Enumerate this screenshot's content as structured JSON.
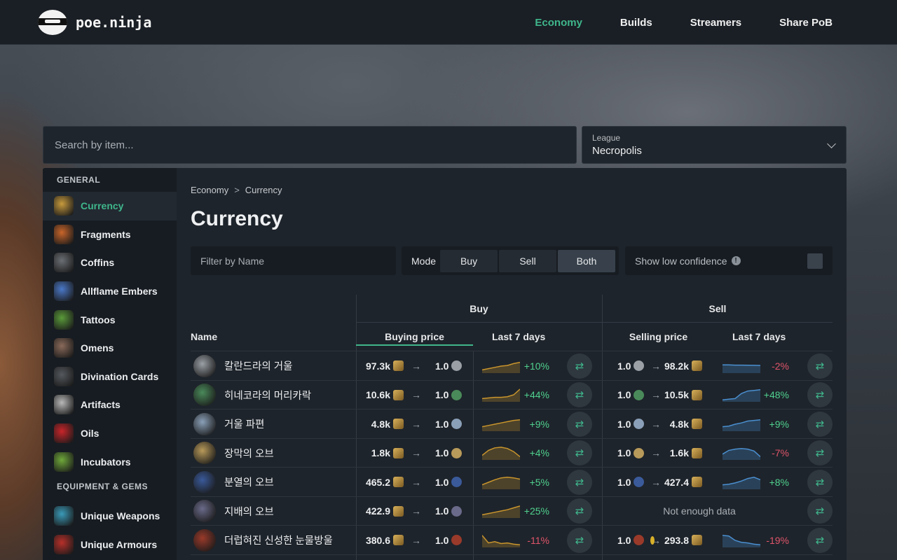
{
  "app": {
    "logo_text": "poe.ninja",
    "nav": [
      {
        "label": "Economy",
        "active": true
      },
      {
        "label": "Builds",
        "active": false
      },
      {
        "label": "Streamers",
        "active": false
      },
      {
        "label": "Share PoB",
        "active": false
      }
    ]
  },
  "search": {
    "placeholder": "Search by item..."
  },
  "league": {
    "label": "League",
    "value": "Necropolis"
  },
  "sidebar": {
    "general_heading": "GENERAL",
    "general_items": [
      {
        "label": "Currency",
        "icon": "currency-icon",
        "color": "#c79a3d",
        "active": true
      },
      {
        "label": "Fragments",
        "icon": "fragments-icon",
        "color": "#c8652a"
      },
      {
        "label": "Coffins",
        "icon": "coffins-icon",
        "color": "#6b6f74"
      },
      {
        "label": "Allflame Embers",
        "icon": "allflame-embers-icon",
        "color": "#4a78c8"
      },
      {
        "label": "Tattoos",
        "icon": "tattoos-icon",
        "color": "#5a9a3a"
      },
      {
        "label": "Omens",
        "icon": "omens-icon",
        "color": "#8a6a5a"
      },
      {
        "label": "Divination Cards",
        "icon": "divination-cards-icon",
        "color": "#55595e"
      },
      {
        "label": "Artifacts",
        "icon": "artifacts-icon",
        "color": "#b8b8b8"
      },
      {
        "label": "Oils",
        "icon": "oils-icon",
        "color": "#c8252a"
      },
      {
        "label": "Incubators",
        "icon": "incubators-icon",
        "color": "#6fa83a"
      }
    ],
    "equipment_heading": "EQUIPMENT & GEMS",
    "equipment_items": [
      {
        "label": "Unique Weapons",
        "icon": "unique-weapons-icon",
        "color": "#3a9ab8"
      },
      {
        "label": "Unique Armours",
        "icon": "unique-armours-icon",
        "color": "#b8302a"
      }
    ]
  },
  "main": {
    "breadcrumb": [
      "Economy",
      "Currency"
    ],
    "breadcrumb_sep": ">",
    "title": "Currency",
    "filter_placeholder": "Filter by Name",
    "mode_label": "Mode",
    "mode_options": [
      "Buy",
      "Sell",
      "Both"
    ],
    "mode_selected": "Both",
    "low_confidence_label": "Show low confidence",
    "info_glyph": "!"
  },
  "table": {
    "group_buy": "Buy",
    "group_sell": "Sell",
    "col_name": "Name",
    "col_buying_price": "Buying price",
    "col_last7_buy": "Last 7 days",
    "col_selling_price": "Selling price",
    "col_last7_sell": "Last 7 days",
    "arrow": "→",
    "swap_glyph": "⇄",
    "one": "1.0",
    "rows": [
      {
        "name": "칼란드라의 거울",
        "icon_color": "#9aa0a6",
        "buy": "97.3k",
        "buy_change": "+10%",
        "buy_up": true,
        "buy_trend": [
          0.2,
          0.3,
          0.4,
          0.5,
          0.55,
          0.7,
          0.8
        ],
        "sell": "98.2k",
        "sell_change": "-2%",
        "sell_up": false,
        "sell_trend": [
          0.6,
          0.6,
          0.58,
          0.58,
          0.57,
          0.56,
          0.55
        ],
        "has_sell": true,
        "warn": false
      },
      {
        "name": "히네코라의 머리카락",
        "icon_color": "#4a8a5a",
        "buy": "10.6k",
        "buy_change": "+44%",
        "buy_up": true,
        "buy_trend": [
          0.2,
          0.25,
          0.3,
          0.3,
          0.35,
          0.5,
          0.95
        ],
        "sell": "10.5k",
        "sell_change": "+48%",
        "sell_up": true,
        "sell_trend": [
          0.1,
          0.15,
          0.2,
          0.6,
          0.8,
          0.85,
          0.9
        ],
        "has_sell": true,
        "warn": false
      },
      {
        "name": "거울 파편",
        "icon_color": "#8aa0b8",
        "buy": "4.8k",
        "buy_change": "+9%",
        "buy_up": true,
        "buy_trend": [
          0.3,
          0.4,
          0.5,
          0.6,
          0.7,
          0.8,
          0.85
        ],
        "sell": "4.8k",
        "sell_change": "+9%",
        "sell_up": true,
        "sell_trend": [
          0.3,
          0.35,
          0.5,
          0.6,
          0.75,
          0.8,
          0.85
        ],
        "has_sell": true,
        "warn": false
      },
      {
        "name": "장막의 오브",
        "icon_color": "#b89a5a",
        "buy": "1.8k",
        "buy_change": "+4%",
        "buy_up": true,
        "buy_trend": [
          0.3,
          0.7,
          0.9,
          0.95,
          0.85,
          0.6,
          0.2
        ],
        "sell": "1.6k",
        "sell_change": "-7%",
        "sell_up": false,
        "sell_trend": [
          0.4,
          0.7,
          0.8,
          0.85,
          0.8,
          0.65,
          0.2
        ],
        "has_sell": true,
        "warn": false
      },
      {
        "name": "분열의 오브",
        "icon_color": "#3a5a9a",
        "buy": "465.2",
        "buy_change": "+5%",
        "buy_up": true,
        "buy_trend": [
          0.3,
          0.5,
          0.7,
          0.85,
          0.9,
          0.85,
          0.75
        ],
        "sell": "427.4",
        "sell_change": "+8%",
        "sell_up": true,
        "sell_trend": [
          0.3,
          0.35,
          0.45,
          0.6,
          0.8,
          0.9,
          0.7
        ],
        "has_sell": true,
        "warn": false
      },
      {
        "name": "지배의 오브",
        "icon_color": "#6a6a8a",
        "buy": "422.9",
        "buy_change": "+25%",
        "buy_up": true,
        "buy_trend": [
          0.2,
          0.3,
          0.4,
          0.5,
          0.6,
          0.75,
          0.9
        ],
        "sell_text": "Not enough data",
        "has_sell": false,
        "warn": false
      },
      {
        "name": "더럽혀진 신성한 눈물방울",
        "icon_color": "#9a3a2a",
        "buy": "380.6",
        "buy_change": "-11%",
        "buy_up": false,
        "buy_trend": [
          0.9,
          0.3,
          0.4,
          0.25,
          0.3,
          0.2,
          0.15
        ],
        "sell": "293.8",
        "sell_change": "-19%",
        "sell_up": false,
        "sell_trend": [
          0.9,
          0.85,
          0.5,
          0.35,
          0.3,
          0.2,
          0.15
        ],
        "has_sell": true,
        "warn": true
      }
    ]
  },
  "colors": {
    "accent": "#3fb68b",
    "up": "#4fd18f",
    "down": "#e0556b",
    "buy_spark": "#c9952c",
    "sell_spark": "#4a8fd0"
  }
}
